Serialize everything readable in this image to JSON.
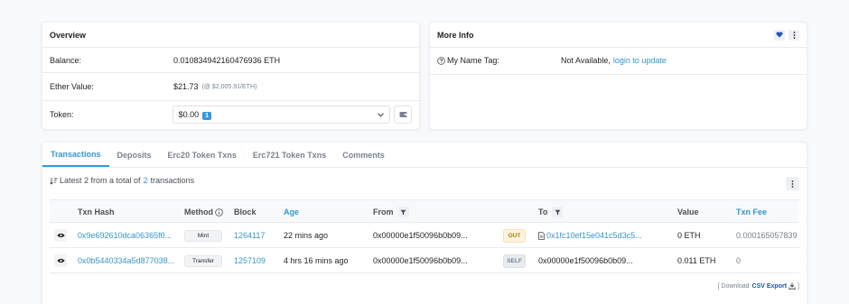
{
  "overview": {
    "title": "Overview",
    "balance_label": "Balance:",
    "balance_value": "0.010834942160476936 ETH",
    "ether_value_label": "Ether Value:",
    "ether_value": "$21.73",
    "ether_rate": "(@ $2,005.91/ETH)",
    "token_label": "Token:",
    "token_value": "$0.00",
    "token_count": "1"
  },
  "more_info": {
    "title": "More Info",
    "name_tag_label": "My Name Tag:",
    "name_tag_value": "Not Available,",
    "name_tag_link": "login to update"
  },
  "tabs": [
    {
      "label": "Transactions",
      "active": true
    },
    {
      "label": "Deposits"
    },
    {
      "label": "Erc20 Token Txns"
    },
    {
      "label": "Erc721 Token Txns"
    },
    {
      "label": "Comments"
    }
  ],
  "summary": {
    "prefix": "Latest 2 from a total of",
    "count": "2",
    "suffix": "transactions"
  },
  "table": {
    "headers": {
      "hash": "Txn Hash",
      "method": "Method",
      "block": "Block",
      "age": "Age",
      "from": "From",
      "to": "To",
      "value": "Value",
      "fee": "Txn Fee"
    },
    "rows": [
      {
        "hash": "0x9e692610dca06365f0...",
        "method": "Mint",
        "block": "1264117",
        "age": "22 mins ago",
        "from": "0x00000e1f50096b0b09...",
        "direction": "OUT",
        "to": "0x1fc10ef15e041c5d3c5...",
        "value": "0 ETH",
        "fee": "0.000165057839"
      },
      {
        "hash": "0x0b5440334a5d877038...",
        "method": "Transfer",
        "block": "1257109",
        "age": "4 hrs 16 mins ago",
        "from": "0x00000e1f50096b0b09...",
        "direction": "SELF",
        "to": "0x00000e1f50096b0b09...",
        "value": "0.011 ETH",
        "fee": "0"
      }
    ]
  },
  "footer": {
    "open": "[ Download",
    "link": "CSV Export",
    "close": "]"
  },
  "colors": {
    "accent": "#3498db",
    "out_badge": "#fdf3de",
    "self_badge": "#e9ecef"
  }
}
